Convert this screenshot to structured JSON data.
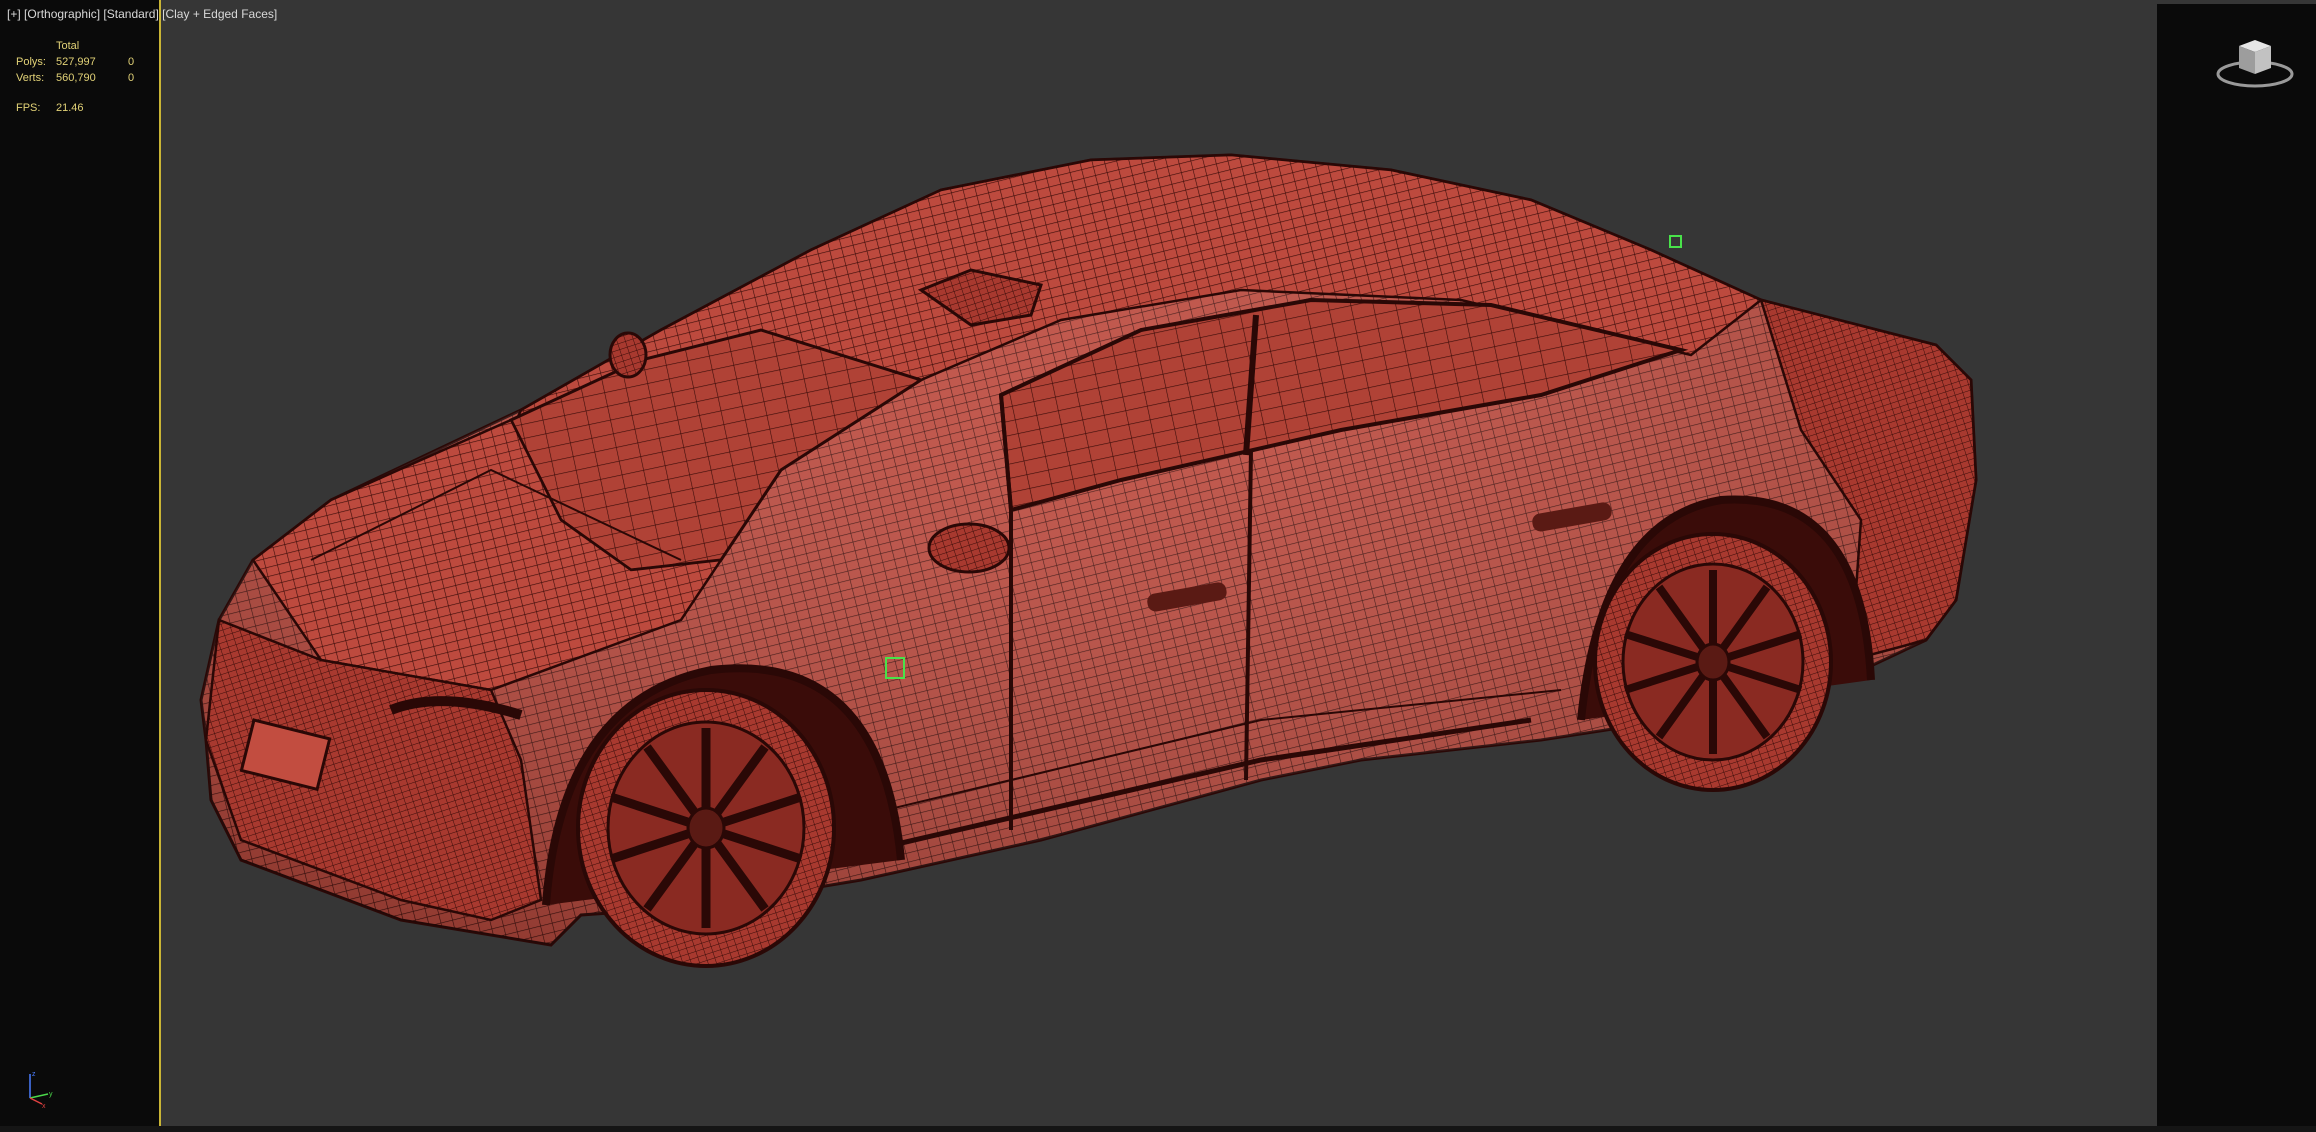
{
  "viewport": {
    "label_plus": "[+]",
    "label_view": "[Orthographic]",
    "label_shading_style": "[Standard]",
    "label_shading": "[Clay + Edged Faces]"
  },
  "stats": {
    "header_total": "Total",
    "polys_label": "Polys:",
    "polys_total": "527,997",
    "polys_selected": "0",
    "verts_label": "Verts:",
    "verts_total": "560,790",
    "verts_selected": "0",
    "fps_label": "FPS:",
    "fps_value": "21.46"
  },
  "axis_gizmo": {
    "x": "x",
    "y": "y",
    "z": "z"
  },
  "colors": {
    "viewport_border": "#c9b535",
    "viewport_background": "#363636",
    "clay_fill": "#bd4a3e",
    "wire_edges": "#3a0c09",
    "stats_text": "#e2d277",
    "selection_marker": "#49e24a"
  },
  "icons": [
    "viewcube-icon",
    "axis-tripod-icon",
    "selection-marker-icon"
  ]
}
